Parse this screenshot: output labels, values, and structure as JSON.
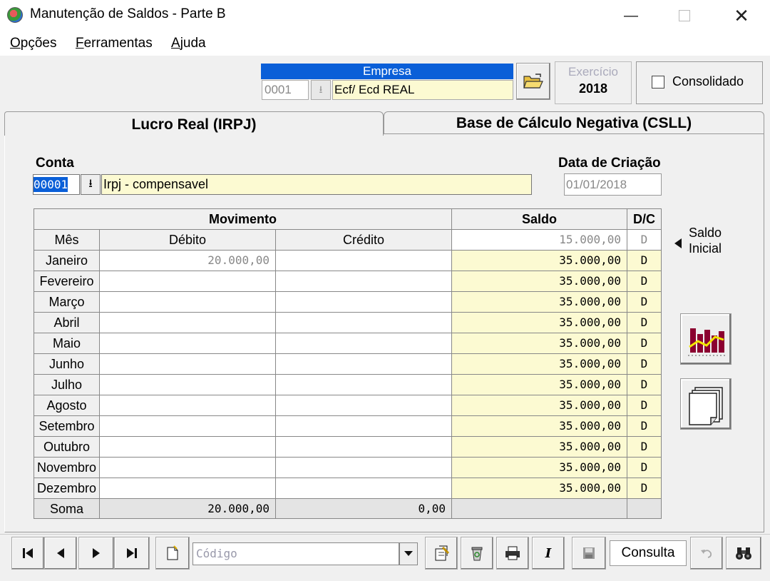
{
  "window": {
    "title": "Manutenção de Saldos - Parte B",
    "minimize": "—",
    "close": "✕"
  },
  "menu": [
    {
      "underline": "O",
      "rest": "pções"
    },
    {
      "underline": "F",
      "rest": "erramentas"
    },
    {
      "underline": "A",
      "rest": "juda"
    }
  ],
  "empresa": {
    "header": "Empresa",
    "code": "0001",
    "name": "Ecf/ Ecd REAL"
  },
  "exercicio": {
    "label": "Exercício",
    "value": "2018"
  },
  "consolidado": {
    "label": "Consolidado",
    "checked": false
  },
  "tabs": [
    {
      "label": "Lucro Real (IRPJ)",
      "active": true
    },
    {
      "label": "Base de Cálculo Negativa (CSLL)",
      "active": false
    }
  ],
  "conta": {
    "label": "Conta",
    "code": "00001",
    "name": "Irpj - compensavel"
  },
  "data_criacao": {
    "label": "Data de Criação",
    "value": "01/01/2018"
  },
  "grid": {
    "group_headers": {
      "movimento": "Movimento",
      "saldo": "Saldo",
      "dc": "D/C"
    },
    "col_headers": {
      "mes": "Mês",
      "debito": "Débito",
      "credito": "Crédito"
    },
    "saldo_inicial": {
      "value": "15.000,00",
      "dc": "D"
    },
    "rows": [
      {
        "mes": "Janeiro",
        "debito": "20.000,00",
        "credito": "",
        "saldo": "35.000,00",
        "dc": "D"
      },
      {
        "mes": "Fevereiro",
        "debito": "",
        "credito": "",
        "saldo": "35.000,00",
        "dc": "D"
      },
      {
        "mes": "Março",
        "debito": "",
        "credito": "",
        "saldo": "35.000,00",
        "dc": "D"
      },
      {
        "mes": "Abril",
        "debito": "",
        "credito": "",
        "saldo": "35.000,00",
        "dc": "D"
      },
      {
        "mes": "Maio",
        "debito": "",
        "credito": "",
        "saldo": "35.000,00",
        "dc": "D"
      },
      {
        "mes": "Junho",
        "debito": "",
        "credito": "",
        "saldo": "35.000,00",
        "dc": "D"
      },
      {
        "mes": "Julho",
        "debito": "",
        "credito": "",
        "saldo": "35.000,00",
        "dc": "D"
      },
      {
        "mes": "Agosto",
        "debito": "",
        "credito": "",
        "saldo": "35.000,00",
        "dc": "D"
      },
      {
        "mes": "Setembro",
        "debito": "",
        "credito": "",
        "saldo": "35.000,00",
        "dc": "D"
      },
      {
        "mes": "Outubro",
        "debito": "",
        "credito": "",
        "saldo": "35.000,00",
        "dc": "D"
      },
      {
        "mes": "Novembro",
        "debito": "",
        "credito": "",
        "saldo": "35.000,00",
        "dc": "D"
      },
      {
        "mes": "Dezembro",
        "debito": "",
        "credito": "",
        "saldo": "35.000,00",
        "dc": "D"
      }
    ],
    "soma": {
      "label": "Soma",
      "debito": "20.000,00",
      "credito": "0,00"
    }
  },
  "saldo_inicial_label": {
    "line1": "Saldo",
    "line2": "Inicial"
  },
  "toolbar": {
    "codigo_placeholder": "Código",
    "mode": "Consulta",
    "icons": [
      "first-record-icon",
      "previous-record-icon",
      "next-record-icon",
      "last-record-icon",
      "new-document-icon",
      "edit-document-icon",
      "recycle-bin-icon",
      "printer-icon",
      "italic-icon",
      "save-icon",
      "undo-icon",
      "binoculars-icon"
    ]
  },
  "colors": {
    "accent": "#0a5fd8",
    "input_yellow": "#fcfad2",
    "chart_bar": "#8b0030",
    "chart_line": "#f2e600"
  }
}
